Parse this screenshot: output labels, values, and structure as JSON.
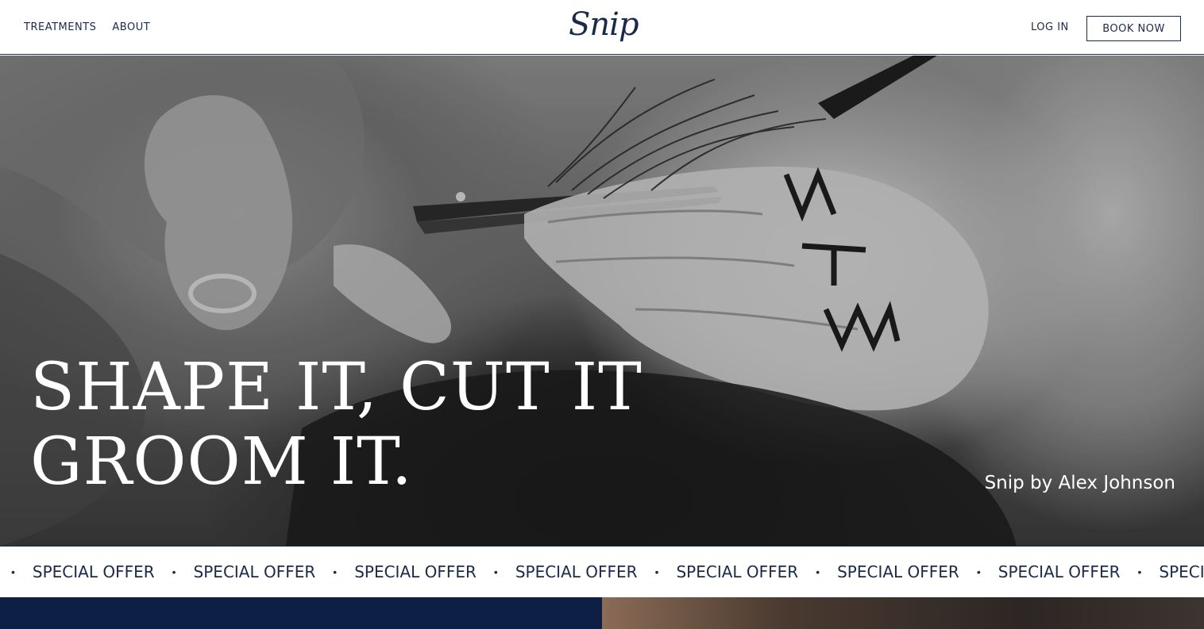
{
  "header": {
    "nav": [
      {
        "label": "TREATMENTS"
      },
      {
        "label": "ABOUT"
      }
    ],
    "logo": "Snip",
    "login_label": "LOG IN",
    "book_label": "BOOK NOW"
  },
  "hero": {
    "title_line1": "SHAPE IT, CUT IT",
    "title_line2": "GROOM IT.",
    "credit": "Snip by Alex Johnson"
  },
  "ticker": {
    "items": [
      "SPECIAL OFFER",
      "SPECIAL OFFER",
      "SPECIAL OFFER",
      "SPECIAL OFFER",
      "SPECIAL OFFER",
      "SPECIAL OFFER",
      "SPECIAL OFFER",
      "SPECIAL OFFER"
    ],
    "separator": "•"
  },
  "colors": {
    "navy": "#1b2a4a",
    "dark_navy_panel": "#0d1f45"
  }
}
